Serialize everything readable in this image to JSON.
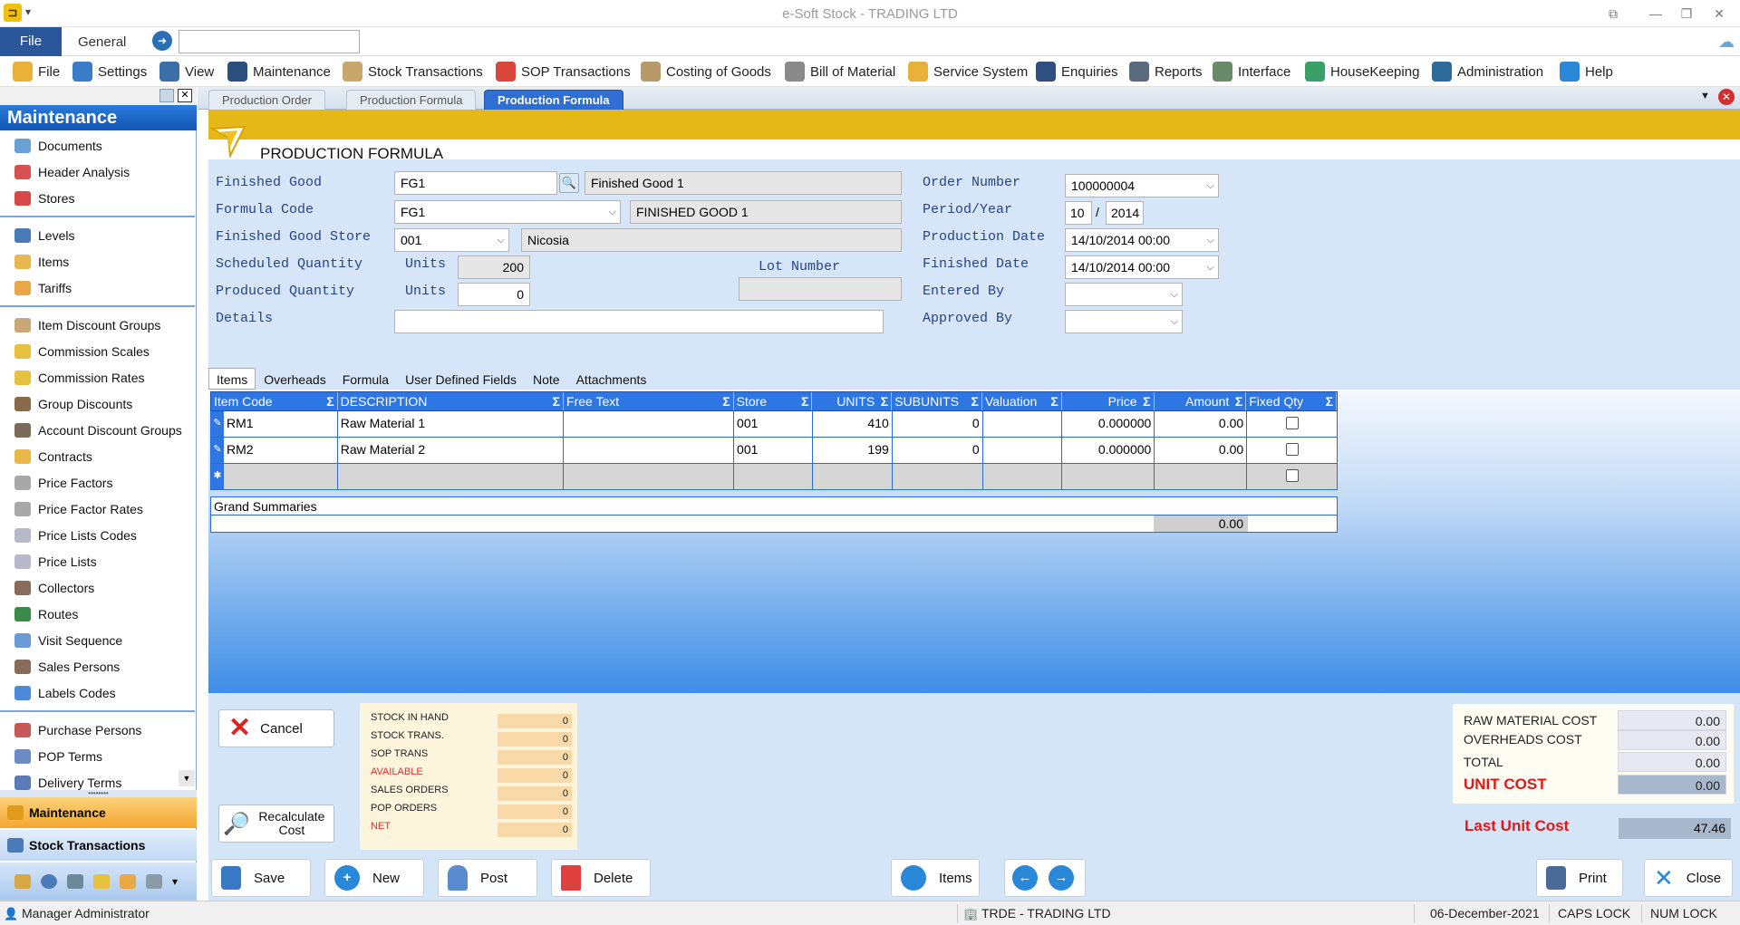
{
  "window": {
    "title": "e-Soft Stock - TRADING LTD"
  },
  "ribbon": {
    "file_tab": "File",
    "general_tab": "General",
    "search_value": ""
  },
  "menu": [
    {
      "label": "File",
      "icon": "folder-icon",
      "color": "#e8b23a"
    },
    {
      "label": "Settings",
      "icon": "gears-icon",
      "color": "#3a7cc7"
    },
    {
      "label": "View",
      "icon": "monitor-icon",
      "color": "#3b6fa8"
    },
    {
      "label": "Maintenance",
      "icon": "monitor-chart-icon",
      "color": "#2b4f7d"
    },
    {
      "label": "Stock Transactions",
      "icon": "boxes-icon",
      "color": "#c9a76a"
    },
    {
      "label": "SOP Transactions",
      "icon": "sop-icon",
      "color": "#d9463a"
    },
    {
      "label": "Costing of Goods",
      "icon": "costing-icon",
      "color": "#b89a6a"
    },
    {
      "label": "Bill of Material",
      "icon": "document-list-icon",
      "color": "#8a8a8a"
    },
    {
      "label": "Service System",
      "icon": "wrench-icon",
      "color": "#e8b23a"
    },
    {
      "label": "Enquiries",
      "icon": "folder-search-icon",
      "color": "#2e4f80"
    },
    {
      "label": "Reports",
      "icon": "clipboard-icon",
      "color": "#5a6b7e"
    },
    {
      "label": "Interface",
      "icon": "interface-icon",
      "color": "#6a8a6a"
    },
    {
      "label": "HouseKeeping",
      "icon": "housekeeping-icon",
      "color": "#3aa06a"
    },
    {
      "label": "Administration",
      "icon": "binders-icon",
      "color": "#2e6a9a"
    },
    {
      "label": "Help",
      "icon": "help-icon",
      "color": "#2a88d8"
    }
  ],
  "sidebar": {
    "header": "Maintenance",
    "items": [
      {
        "label": "Documents",
        "icon": "documents-icon",
        "color": "#6aa0d8"
      },
      {
        "label": "Header Analysis",
        "icon": "analysis-icon",
        "color": "#d85050"
      },
      {
        "label": "Stores",
        "icon": "ruby-icon",
        "color": "#d84848"
      },
      {
        "label": "Levels",
        "icon": "levels-icon",
        "color": "#4a7ab8"
      },
      {
        "label": "Items",
        "icon": "box-icon",
        "color": "#e8b850"
      },
      {
        "label": "Tariffs",
        "icon": "tariffs-icon",
        "color": "#e8a848"
      },
      {
        "label": "Item Discount Groups",
        "icon": "discount-box-icon",
        "color": "#c8a878"
      },
      {
        "label": "Commission Scales",
        "icon": "coins-icon",
        "color": "#e8c040"
      },
      {
        "label": "Commission Rates",
        "icon": "coins-icon",
        "color": "#e8c040"
      },
      {
        "label": "Group Discounts",
        "icon": "group-icon",
        "color": "#8a6a48"
      },
      {
        "label": "Account Discount Groups",
        "icon": "account-group-icon",
        "color": "#7a6a58"
      },
      {
        "label": "Contracts",
        "icon": "contracts-icon",
        "color": "#e8b848"
      },
      {
        "label": "Price Factors",
        "icon": "price-factor-icon",
        "color": "#a8a8a8"
      },
      {
        "label": "Price Factor Rates",
        "icon": "price-factor-rates-icon",
        "color": "#a8a8a8"
      },
      {
        "label": "Price Lists Codes",
        "icon": "price-list-codes-icon",
        "color": "#b8b8c8"
      },
      {
        "label": "Price Lists",
        "icon": "price-list-icon",
        "color": "#b8b8c8"
      },
      {
        "label": "Collectors",
        "icon": "person-icon",
        "color": "#8a6a58"
      },
      {
        "label": "Routes",
        "icon": "routes-icon",
        "color": "#3a8a4a"
      },
      {
        "label": "Visit Sequence",
        "icon": "visit-sequence-icon",
        "color": "#6a9ad8"
      },
      {
        "label": "Sales Persons",
        "icon": "sales-person-icon",
        "color": "#8a6a58"
      },
      {
        "label": "Labels Codes",
        "icon": "labels-icon",
        "color": "#4a8ad8"
      },
      {
        "label": "Purchase Persons",
        "icon": "purchase-person-icon",
        "color": "#c85858"
      },
      {
        "label": "POP Terms",
        "icon": "pop-terms-icon",
        "color": "#6a8ac8"
      },
      {
        "label": "Delivery Terms",
        "icon": "truck-icon",
        "color": "#5a7ab8"
      }
    ],
    "bottom_tabs": [
      {
        "label": "Maintenance"
      },
      {
        "label": "Stock Transactions"
      }
    ]
  },
  "doc_tabs": [
    "Production Order",
    "Production Formula",
    "Production Formula"
  ],
  "form": {
    "title": "PRODUCTION FORMULA",
    "labels": {
      "finished_good": "Finished Good",
      "formula_code": "Formula Code",
      "finished_good_store": "Finished Good Store",
      "scheduled_quantity": "Scheduled Quantity",
      "produced_quantity": "Produced Quantity",
      "details": "Details",
      "units": "Units",
      "lot_number": "Lot Number",
      "order_number": "Order Number",
      "period_year": "Period/Year",
      "production_date": "Production Date",
      "finished_date": "Finished Date",
      "entered_by": "Entered By",
      "approved_by": "Approved By"
    },
    "values": {
      "finished_good_code": "FG1",
      "finished_good_desc": "Finished Good 1",
      "formula_code": "FG1",
      "formula_desc": "FINISHED GOOD 1",
      "store_code": "001",
      "store_name": "Nicosia",
      "scheduled_qty": "200",
      "produced_qty": "0",
      "lot_number": "",
      "details": "",
      "order_number": "100000004",
      "period": "10",
      "period_sep": "/",
      "year": "2014",
      "production_date": "14/10/2014 00:00",
      "finished_date": "14/10/2014 00:00",
      "entered_by": "",
      "approved_by": ""
    }
  },
  "inner_tabs": [
    "Items",
    "Overheads",
    "Formula",
    "User Defined Fields",
    "Note",
    "Attachments"
  ],
  "grid": {
    "columns": [
      "Item Code",
      "DESCRIPTION",
      "Free Text",
      "Store",
      "UNITS",
      "SUBUNITS",
      "Valuation",
      "Price",
      "Amount",
      "Fixed Qty"
    ],
    "rows": [
      {
        "item_code": "RM1",
        "description": "Raw Material 1",
        "free_text": "",
        "store": "001",
        "units": "410",
        "subunits": "0",
        "valuation": "",
        "price": "0.000000",
        "amount": "0.00",
        "fixed_qty": false
      },
      {
        "item_code": "RM2",
        "description": "Raw Material 2",
        "free_text": "",
        "store": "001",
        "units": "199",
        "subunits": "0",
        "valuation": "",
        "price": "0.000000",
        "amount": "0.00",
        "fixed_qty": false
      }
    ],
    "summary_label": "Grand Summaries",
    "summary_amount": "0.00"
  },
  "actions": {
    "cancel": "Cancel",
    "recalculate": "Recalculate Cost"
  },
  "stock_summary": [
    {
      "label": "STOCK IN HAND",
      "value": "0",
      "color": "#222222"
    },
    {
      "label": "STOCK TRANS.",
      "value": "0",
      "color": "#222222"
    },
    {
      "label": "SOP TRANS",
      "value": "0",
      "color": "#222222"
    },
    {
      "label": "AVAILABLE",
      "value": "0",
      "color": "#e03030"
    },
    {
      "label": "SALES ORDERS",
      "value": "0",
      "color": "#222222"
    },
    {
      "label": "POP ORDERS",
      "value": "0",
      "color": "#222222"
    },
    {
      "label": "NET",
      "value": "0",
      "color": "#e03030"
    }
  ],
  "costs": {
    "raw_material_cost_label": "RAW MATERIAL COST",
    "raw_material_cost": "0.00",
    "overheads_cost_label": "OVERHEADS COST",
    "overheads_cost": "0.00",
    "total_label": "TOTAL",
    "total": "0.00",
    "unit_cost_label": "UNIT COST",
    "unit_cost": "0.00",
    "last_unit_cost_label": "Last Unit Cost",
    "last_unit_cost": "47.46",
    "accent_color": "#e01818"
  },
  "buttons": {
    "save": "Save",
    "new": "New",
    "post": "Post",
    "delete": "Delete",
    "items": "Items",
    "print": "Print",
    "close": "Close"
  },
  "status": {
    "user": "Manager Administrator",
    "company": "TRDE - TRADING LTD",
    "date": "06-December-2021",
    "caps": "CAPS LOCK",
    "num": "NUM LOCK"
  }
}
